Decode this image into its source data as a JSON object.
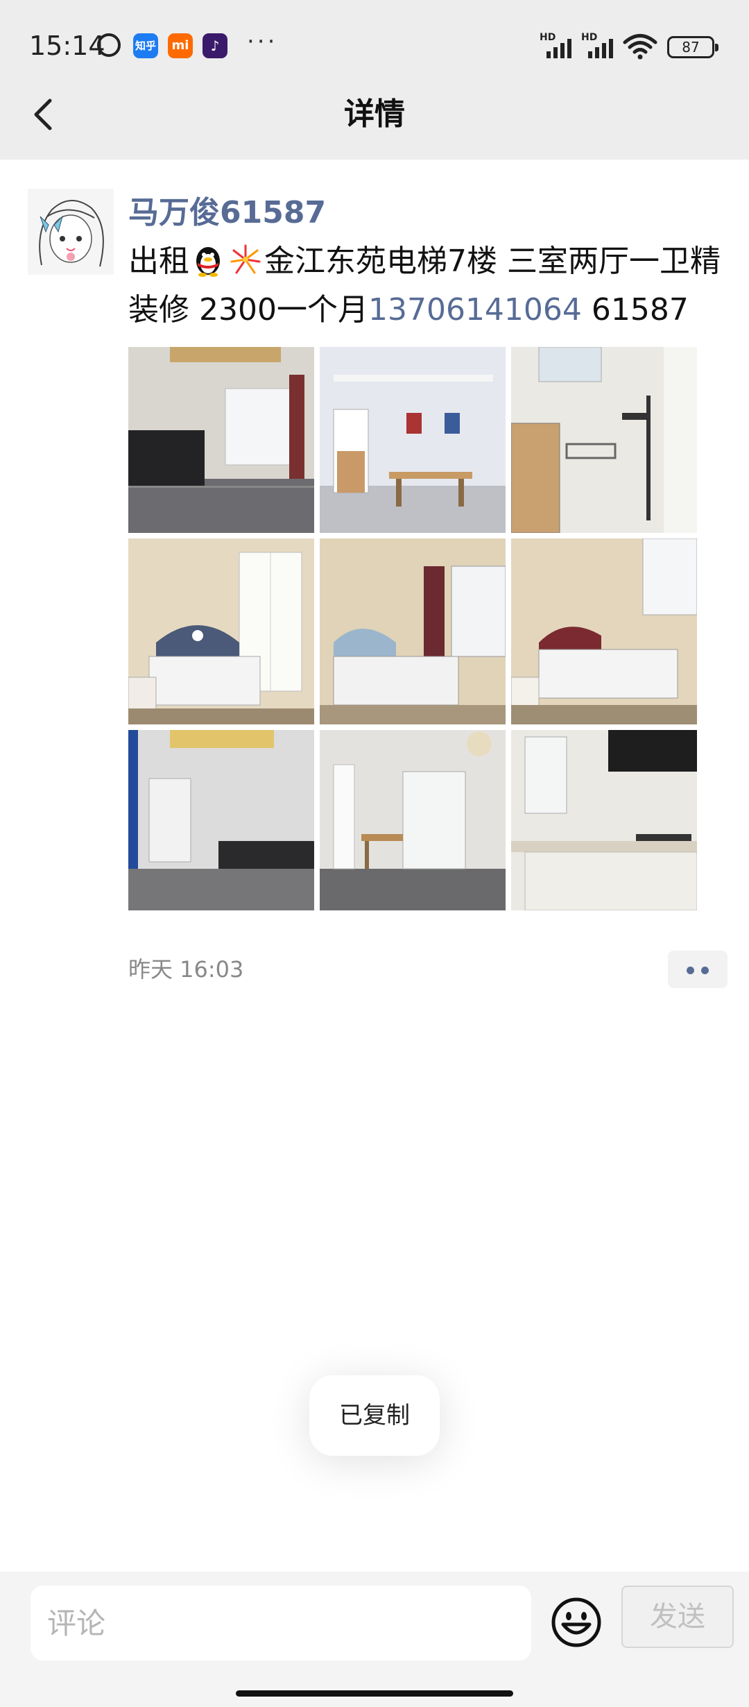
{
  "status_bar": {
    "time": "15:14",
    "zhihu_label": "知乎",
    "mi_label": "mi",
    "battery": "87",
    "signal_labels": [
      "HD",
      "HD"
    ]
  },
  "header": {
    "title": "详情"
  },
  "post": {
    "author": "马万俊61587",
    "text_part1": "出租",
    "text_part2": "金江东苑电梯7楼  三室两厅一卫精装修  2300一个月",
    "phone": "13706141064",
    "text_part3": "  61587",
    "photos": [
      "living-room",
      "dining-area",
      "bathroom",
      "bedroom-wardrobe",
      "bedroom-window",
      "bedroom-red-bed",
      "living-room-sofa",
      "dining-balcony",
      "kitchen"
    ],
    "time": "昨天 16:03"
  },
  "toast": {
    "text": "已复制"
  },
  "composer": {
    "placeholder": "评论",
    "send_label": "发送"
  },
  "colors": {
    "link": "#576b95",
    "topbar": "#ededed"
  }
}
